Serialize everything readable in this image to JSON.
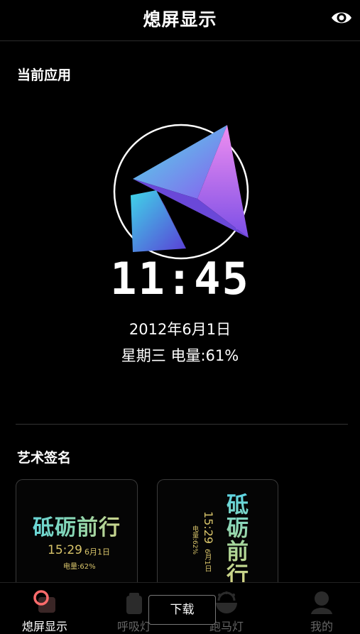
{
  "header": {
    "title": "熄屏显示",
    "eye_icon": "eye-icon"
  },
  "current": {
    "section_title": "当前应用",
    "clock": "11:45",
    "date": "2012年6月1日",
    "week_battery": "星期三  电量:61%"
  },
  "art": {
    "section_title": "艺术签名",
    "card1": {
      "title": "砥砺前行",
      "time": "15:29",
      "date": "6月1日",
      "battery": "电量:62%"
    },
    "card2": {
      "title": "砥砺前行",
      "time": "15:29",
      "date": "6月1日",
      "battery": "电量:62%"
    }
  },
  "tabs": [
    {
      "label": "熄屏显示",
      "icon": "aod-icon",
      "active": true
    },
    {
      "label": "呼吸灯",
      "icon": "breathing-light-icon",
      "active": false
    },
    {
      "label": "跑马灯",
      "icon": "marquee-light-icon",
      "active": false
    },
    {
      "label": "我的",
      "icon": "profile-icon",
      "active": false
    }
  ],
  "download_label": "下载",
  "colors": {
    "background": "#000000",
    "accent_gold": "#d8c46a",
    "accent_cyan": "#5cd6e6",
    "logo_purple": "#8a5cf0"
  }
}
